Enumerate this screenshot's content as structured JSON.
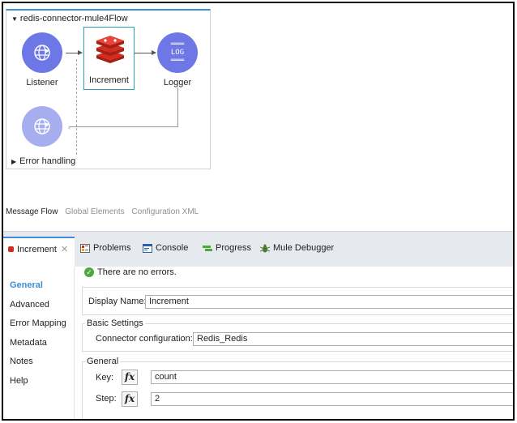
{
  "flow": {
    "title": "redis-connector-mule4Flow",
    "nodes": {
      "listener": "Listener",
      "increment": "Increment",
      "logger": "Logger",
      "logger_icon_text": "LOG"
    },
    "error_handling": "Error handling"
  },
  "editor_tabs": {
    "message_flow": "Message Flow",
    "global_elements": "Global Elements",
    "configuration_xml": "Configuration XML"
  },
  "panel": {
    "active_tab": "Increment",
    "close_glyph": "✕",
    "views": {
      "problems": "Problems",
      "console": "Console",
      "progress": "Progress",
      "debugger": "Mule Debugger"
    }
  },
  "sidebar": {
    "items": [
      "General",
      "Advanced",
      "Error Mapping",
      "Metadata",
      "Notes",
      "Help"
    ]
  },
  "form": {
    "status": "There are no errors.",
    "display_name_label": "Display Name:",
    "display_name_value": "Increment",
    "basic_settings_legend": "Basic Settings",
    "connector_config_label": "Connector configuration:",
    "connector_config_value": "Redis_Redis",
    "general_legend": "General",
    "key_label": "Key:",
    "key_value": "count",
    "step_label": "Step:",
    "step_value": "2",
    "fx_label": "fx"
  },
  "colors": {
    "accent": "#3f8fd6",
    "connector_circle": "#6d78e6",
    "redis_red": "#d52b1e",
    "success": "#4aaa3c"
  }
}
